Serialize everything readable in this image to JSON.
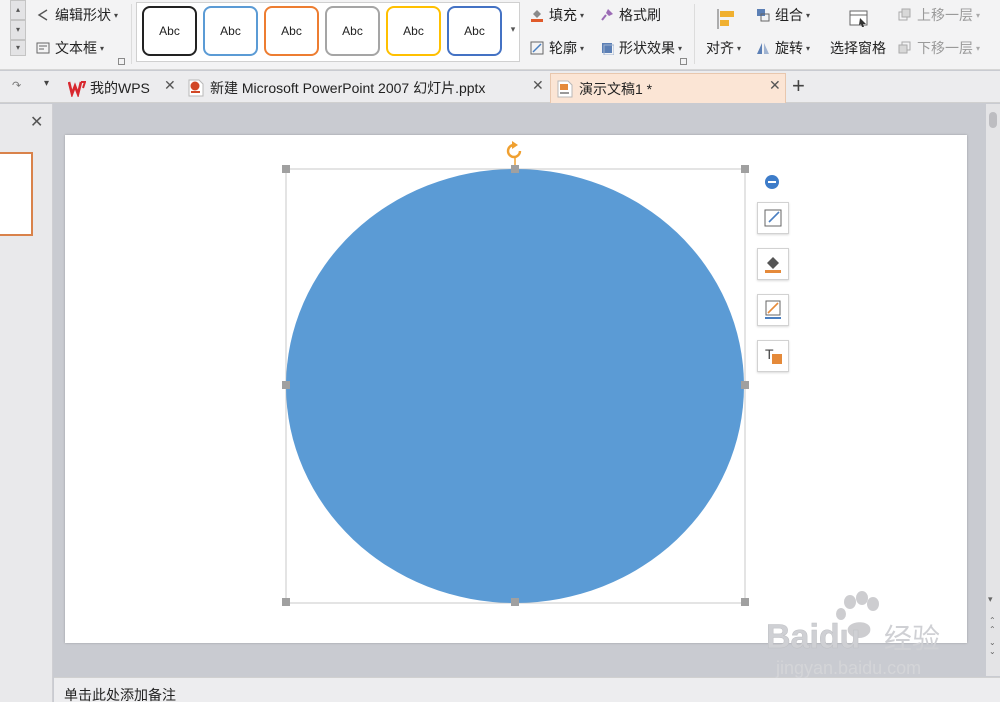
{
  "ribbon": {
    "edit_shape": "编辑形状",
    "text_box": "文本框",
    "style_tiles": [
      {
        "label": "Abc",
        "border": "#1f1f1f"
      },
      {
        "label": "Abc",
        "border": "#5b9bd5"
      },
      {
        "label": "Abc",
        "border": "#ed7d31"
      },
      {
        "label": "Abc",
        "border": "#a5a5a5"
      },
      {
        "label": "Abc",
        "border": "#ffc000"
      },
      {
        "label": "Abc",
        "border": "#4472c4"
      }
    ],
    "fill": "填充",
    "format_painter": "格式刷",
    "outline": "轮廓",
    "shape_effects": "形状效果",
    "align": "对齐",
    "group": "组合",
    "rotate": "旋转",
    "selection_pane": "选择窗格",
    "bring_forward": "上移一层",
    "send_backward": "下移一层"
  },
  "tabs": [
    {
      "label": "我的WPS",
      "icon": "wps-logo-icon",
      "active": false
    },
    {
      "label": "新建 Microsoft PowerPoint 2007 幻灯片.pptx",
      "icon": "pptx-file-icon",
      "active": false
    },
    {
      "label": "演示文稿1 *",
      "icon": "presentation-file-icon",
      "active": true
    }
  ],
  "notes_placeholder": "单击此处添加备注",
  "shape": {
    "type": "ellipse",
    "fill": "#5b9bd5"
  },
  "colors": {
    "accent_tab": "#fbe5d5",
    "thumb_border": "#d9824a",
    "handle": "#a0a0a0",
    "rotate_handle": "#f0a030"
  },
  "watermark": {
    "brand": "Baidu",
    "brand_cn": "经验",
    "url": "jingyan.baidu.com"
  }
}
